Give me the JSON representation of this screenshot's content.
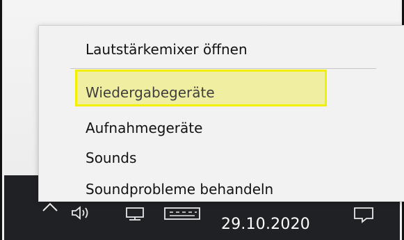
{
  "context_menu": {
    "items": [
      {
        "label": "Lautstärkemixer öffnen"
      },
      {
        "label": "Wiedergabegeräte"
      },
      {
        "label": "Aufnahmegeräte"
      },
      {
        "label": "Sounds"
      },
      {
        "label": "Soundprobleme behandeln"
      }
    ],
    "highlighted_item": "Wiedergabegeräte",
    "highlight_color": "#f3ef00"
  },
  "taskbar": {
    "icons": [
      "chevron-up-icon",
      "speaker-icon",
      "network-icon",
      "keyboard-icon",
      "notification-icon"
    ],
    "date": "29.10.2020"
  }
}
